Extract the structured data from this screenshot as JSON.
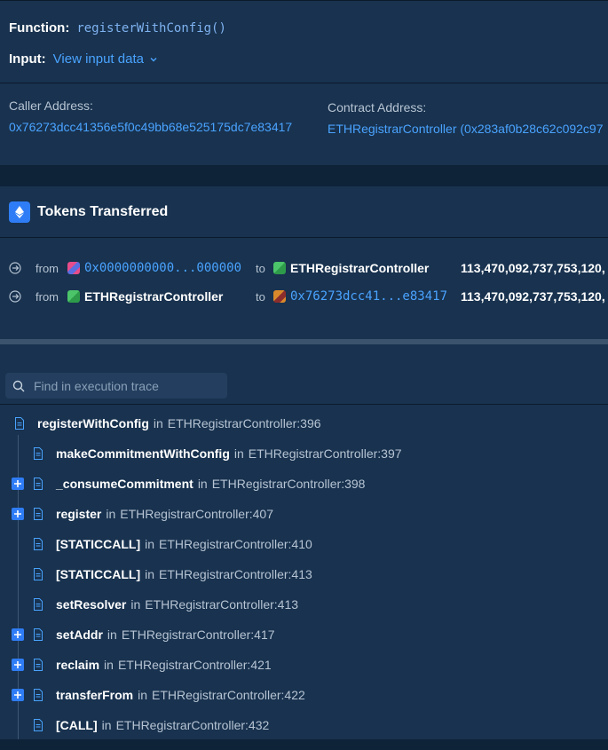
{
  "details": {
    "function_label": "Function:",
    "function_value": "registerWithConfig()",
    "input_label": "Input:",
    "input_link": "View input data",
    "caller_label": "Caller Address:",
    "caller_value": "0x76273dcc41356e5f0c49bb68e525175dc7e83417",
    "contract_label": "Contract Address:",
    "contract_value": "ETHRegistrarController (0x283af0b28c62c092c97"
  },
  "tokens": {
    "title": "Tokens Transferred",
    "rows": [
      {
        "from_label": "from",
        "from": "0x0000000000...000000",
        "to_label": "to",
        "to": "ETHRegistrarController",
        "amount": "113,470,092,737,753,120,"
      },
      {
        "from_label": "from",
        "from": "ETHRegistrarController",
        "to_label": "to",
        "to": "0x76273dcc41...e83417",
        "amount": "113,470,092,737,753,120,"
      }
    ]
  },
  "trace": {
    "search_placeholder": "Find in execution trace",
    "items": [
      {
        "name": "registerWithConfig",
        "in": "in",
        "loc": "ETHRegistrarController:396"
      },
      {
        "name": "makeCommitmentWithConfig",
        "in": "in",
        "loc": "ETHRegistrarController:397"
      },
      {
        "name": "_consumeCommitment",
        "in": "in",
        "loc": "ETHRegistrarController:398"
      },
      {
        "name": "register",
        "in": "in",
        "loc": "ETHRegistrarController:407"
      },
      {
        "name": "[STATICCALL]",
        "in": "in",
        "loc": "ETHRegistrarController:410"
      },
      {
        "name": "[STATICCALL]",
        "in": "in",
        "loc": "ETHRegistrarController:413"
      },
      {
        "name": "setResolver",
        "in": "in",
        "loc": "ETHRegistrarController:413"
      },
      {
        "name": "setAddr",
        "in": "in",
        "loc": "ETHRegistrarController:417"
      },
      {
        "name": "reclaim",
        "in": "in",
        "loc": "ETHRegistrarController:421"
      },
      {
        "name": "transferFrom",
        "in": "in",
        "loc": "ETHRegistrarController:422"
      },
      {
        "name": "[CALL]",
        "in": "in",
        "loc": "ETHRegistrarController:432"
      }
    ]
  },
  "colors": {
    "accent": "#2f7df6",
    "link": "#4aa3ff",
    "panel": "#18324f"
  }
}
